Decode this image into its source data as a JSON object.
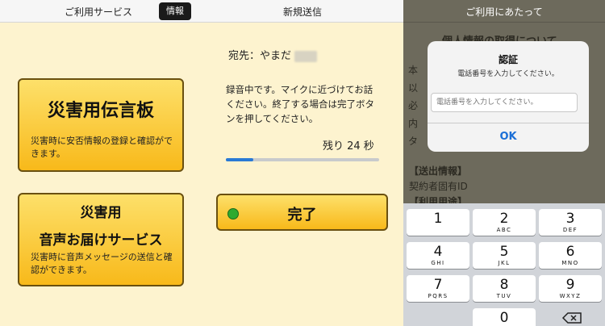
{
  "panel1": {
    "nav_title": "ご利用サービス",
    "info_button": "情報",
    "dengon_title": "災害用伝言板",
    "dengon_desc": "災害時に安否情報の登録と確認ができます。",
    "voice_title_line1": "災害用",
    "voice_title_line2": "音声お届けサービス",
    "voice_desc": "災害時に音声メッセージの送信と確認ができます。"
  },
  "panel2": {
    "nav_title": "新規送信",
    "destination": "宛先：やまだ",
    "recording_message": "録音中です。マイクに近づけてお話ください。終了する場合は完了ボタンを押してください。",
    "remaining": "残り 24 秒",
    "progress_fraction": 0.18,
    "done_button": "完了"
  },
  "panel3": {
    "nav_title": "ご利用にあたって",
    "bg_heading": "個人情報の取得について",
    "bg_lines": [
      "本",
      "以",
      "必",
      "内",
      "タ"
    ],
    "bg_section1": "【送出情報】",
    "bg_item1": "契約者固有ID",
    "bg_section2": "【利用用途】",
    "alert": {
      "title": "認証",
      "message": "電話番号を入力してください。",
      "input_placeholder": "電話番号を入力してください。",
      "ok": "OK"
    },
    "keypad": [
      {
        "num": "1",
        "letters": ""
      },
      {
        "num": "2",
        "letters": "ABC"
      },
      {
        "num": "3",
        "letters": "DEF"
      },
      {
        "num": "4",
        "letters": "GHI"
      },
      {
        "num": "5",
        "letters": "JKL"
      },
      {
        "num": "6",
        "letters": "MNO"
      },
      {
        "num": "7",
        "letters": "PQRS"
      },
      {
        "num": "8",
        "letters": "TUV"
      },
      {
        "num": "9",
        "letters": "WXYZ"
      },
      {
        "num": "0",
        "letters": ""
      }
    ]
  }
}
